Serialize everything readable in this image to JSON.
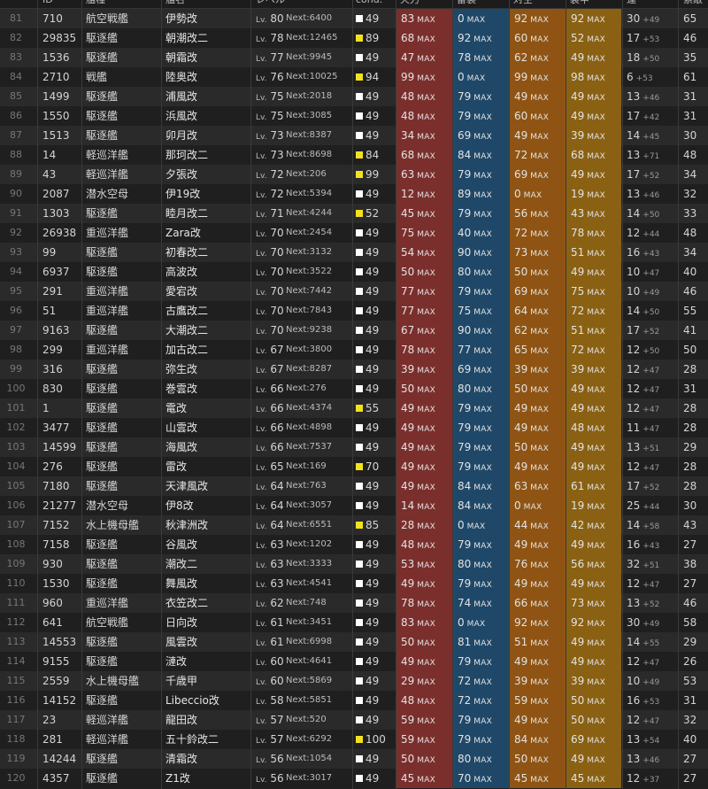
{
  "header": {
    "num": "",
    "id": "ID",
    "type": "艦種",
    "name": "艦名",
    "level": "レベル",
    "cond": "cond.",
    "firepower": "火力",
    "torpedo": "雷装",
    "aa": "対空",
    "armor": "装甲",
    "luck": "運",
    "extra": "索敵"
  },
  "colors": {
    "firepower": "#7b2f2c",
    "torpedo": "#1f4868",
    "antiair": "#8f5413",
    "armor": "#8a6113",
    "cond_yellow": "#f2e21e",
    "cond_white": "#ffffff"
  },
  "labels": {
    "lv": "Lv.",
    "next": "Next:",
    "max": "MAX"
  },
  "rows": [
    {
      "num": "81",
      "id": "710",
      "type": "航空戦艦",
      "name": "伊勢改",
      "lv": "80",
      "next": "6400",
      "cond": "49",
      "fp": "83",
      "tp": "0",
      "aa": "92",
      "ar": "92",
      "luck": "30",
      "luck_add": "+49",
      "ex": "65"
    },
    {
      "num": "82",
      "id": "29835",
      "type": "駆逐艦",
      "name": "朝潮改二",
      "lv": "78",
      "next": "12465",
      "cond": "89",
      "fp": "68",
      "tp": "92",
      "aa": "60",
      "ar": "52",
      "luck": "17",
      "luck_add": "+53",
      "ex": "46"
    },
    {
      "num": "83",
      "id": "1536",
      "type": "駆逐艦",
      "name": "朝霜改",
      "lv": "77",
      "next": "9945",
      "cond": "49",
      "fp": "47",
      "tp": "78",
      "aa": "62",
      "ar": "49",
      "luck": "18",
      "luck_add": "+50",
      "ex": "35"
    },
    {
      "num": "84",
      "id": "2710",
      "type": "戦艦",
      "name": "陸奥改",
      "lv": "76",
      "next": "10025",
      "cond": "94",
      "fp": "99",
      "tp": "0",
      "aa": "99",
      "ar": "98",
      "luck": "6",
      "luck_add": "+53",
      "ex": "61"
    },
    {
      "num": "85",
      "id": "1499",
      "type": "駆逐艦",
      "name": "浦風改",
      "lv": "75",
      "next": "2018",
      "cond": "49",
      "fp": "48",
      "tp": "79",
      "aa": "49",
      "ar": "49",
      "luck": "13",
      "luck_add": "+46",
      "ex": "31"
    },
    {
      "num": "86",
      "id": "1550",
      "type": "駆逐艦",
      "name": "浜風改",
      "lv": "75",
      "next": "3085",
      "cond": "49",
      "fp": "48",
      "tp": "79",
      "aa": "60",
      "ar": "49",
      "luck": "17",
      "luck_add": "+42",
      "ex": "31"
    },
    {
      "num": "87",
      "id": "1513",
      "type": "駆逐艦",
      "name": "卯月改",
      "lv": "73",
      "next": "8387",
      "cond": "49",
      "fp": "34",
      "tp": "69",
      "aa": "49",
      "ar": "39",
      "luck": "14",
      "luck_add": "+45",
      "ex": "30"
    },
    {
      "num": "88",
      "id": "14",
      "type": "軽巡洋艦",
      "name": "那珂改二",
      "lv": "73",
      "next": "8698",
      "cond": "84",
      "fp": "68",
      "tp": "84",
      "aa": "72",
      "ar": "68",
      "luck": "13",
      "luck_add": "+71",
      "ex": "48"
    },
    {
      "num": "89",
      "id": "43",
      "type": "軽巡洋艦",
      "name": "夕張改",
      "lv": "72",
      "next": "206",
      "cond": "99",
      "fp": "63",
      "tp": "79",
      "aa": "69",
      "ar": "49",
      "luck": "17",
      "luck_add": "+52",
      "ex": "34"
    },
    {
      "num": "90",
      "id": "2087",
      "type": "潜水空母",
      "name": "伊19改",
      "lv": "72",
      "next": "5394",
      "cond": "49",
      "fp": "12",
      "tp": "89",
      "aa": "0",
      "ar": "19",
      "luck": "13",
      "luck_add": "+46",
      "ex": "32"
    },
    {
      "num": "91",
      "id": "1303",
      "type": "駆逐艦",
      "name": "睦月改二",
      "lv": "71",
      "next": "4244",
      "cond": "52",
      "fp": "45",
      "tp": "79",
      "aa": "56",
      "ar": "43",
      "luck": "14",
      "luck_add": "+50",
      "ex": "33"
    },
    {
      "num": "92",
      "id": "26938",
      "type": "重巡洋艦",
      "name": "Zara改",
      "lv": "70",
      "next": "2454",
      "cond": "49",
      "fp": "75",
      "tp": "40",
      "aa": "72",
      "ar": "78",
      "luck": "12",
      "luck_add": "+44",
      "ex": "48"
    },
    {
      "num": "93",
      "id": "99",
      "type": "駆逐艦",
      "name": "初春改二",
      "lv": "70",
      "next": "3132",
      "cond": "49",
      "fp": "54",
      "tp": "90",
      "aa": "73",
      "ar": "51",
      "luck": "16",
      "luck_add": "+43",
      "ex": "34"
    },
    {
      "num": "94",
      "id": "6937",
      "type": "駆逐艦",
      "name": "高波改",
      "lv": "70",
      "next": "3522",
      "cond": "49",
      "fp": "50",
      "tp": "80",
      "aa": "50",
      "ar": "49",
      "luck": "10",
      "luck_add": "+47",
      "ex": "40"
    },
    {
      "num": "95",
      "id": "291",
      "type": "重巡洋艦",
      "name": "愛宕改",
      "lv": "70",
      "next": "7442",
      "cond": "49",
      "fp": "77",
      "tp": "79",
      "aa": "69",
      "ar": "75",
      "luck": "10",
      "luck_add": "+49",
      "ex": "46"
    },
    {
      "num": "96",
      "id": "51",
      "type": "重巡洋艦",
      "name": "古鷹改二",
      "lv": "70",
      "next": "7843",
      "cond": "49",
      "fp": "77",
      "tp": "75",
      "aa": "64",
      "ar": "72",
      "luck": "14",
      "luck_add": "+50",
      "ex": "55"
    },
    {
      "num": "97",
      "id": "9163",
      "type": "駆逐艦",
      "name": "大潮改二",
      "lv": "70",
      "next": "9238",
      "cond": "49",
      "fp": "67",
      "tp": "90",
      "aa": "62",
      "ar": "51",
      "luck": "17",
      "luck_add": "+52",
      "ex": "41"
    },
    {
      "num": "98",
      "id": "299",
      "type": "重巡洋艦",
      "name": "加古改二",
      "lv": "67",
      "next": "3800",
      "cond": "49",
      "fp": "78",
      "tp": "77",
      "aa": "65",
      "ar": "72",
      "luck": "12",
      "luck_add": "+50",
      "ex": "50"
    },
    {
      "num": "99",
      "id": "316",
      "type": "駆逐艦",
      "name": "弥生改",
      "lv": "67",
      "next": "8287",
      "cond": "49",
      "fp": "39",
      "tp": "69",
      "aa": "39",
      "ar": "39",
      "luck": "12",
      "luck_add": "+47",
      "ex": "28"
    },
    {
      "num": "100",
      "id": "830",
      "type": "駆逐艦",
      "name": "巻雲改",
      "lv": "66",
      "next": "276",
      "cond": "49",
      "fp": "50",
      "tp": "80",
      "aa": "50",
      "ar": "49",
      "luck": "12",
      "luck_add": "+47",
      "ex": "31"
    },
    {
      "num": "101",
      "id": "1",
      "type": "駆逐艦",
      "name": "電改",
      "lv": "66",
      "next": "4374",
      "cond": "55",
      "fp": "49",
      "tp": "79",
      "aa": "49",
      "ar": "49",
      "luck": "12",
      "luck_add": "+47",
      "ex": "28"
    },
    {
      "num": "102",
      "id": "3477",
      "type": "駆逐艦",
      "name": "山雲改",
      "lv": "66",
      "next": "4898",
      "cond": "49",
      "fp": "49",
      "tp": "79",
      "aa": "49",
      "ar": "48",
      "luck": "11",
      "luck_add": "+47",
      "ex": "28"
    },
    {
      "num": "103",
      "id": "14599",
      "type": "駆逐艦",
      "name": "海風改",
      "lv": "66",
      "next": "7537",
      "cond": "49",
      "fp": "49",
      "tp": "79",
      "aa": "50",
      "ar": "49",
      "luck": "13",
      "luck_add": "+51",
      "ex": "29"
    },
    {
      "num": "104",
      "id": "276",
      "type": "駆逐艦",
      "name": "雷改",
      "lv": "65",
      "next": "169",
      "cond": "70",
      "fp": "49",
      "tp": "79",
      "aa": "49",
      "ar": "49",
      "luck": "12",
      "luck_add": "+47",
      "ex": "28"
    },
    {
      "num": "105",
      "id": "7180",
      "type": "駆逐艦",
      "name": "天津風改",
      "lv": "64",
      "next": "763",
      "cond": "49",
      "fp": "49",
      "tp": "84",
      "aa": "63",
      "ar": "61",
      "luck": "17",
      "luck_add": "+52",
      "ex": "28"
    },
    {
      "num": "106",
      "id": "21277",
      "type": "潜水空母",
      "name": "伊8改",
      "lv": "64",
      "next": "3057",
      "cond": "49",
      "fp": "14",
      "tp": "84",
      "aa": "0",
      "ar": "19",
      "luck": "25",
      "luck_add": "+44",
      "ex": "30"
    },
    {
      "num": "107",
      "id": "7152",
      "type": "水上機母艦",
      "name": "秋津洲改",
      "lv": "64",
      "next": "6551",
      "cond": "85",
      "fp": "28",
      "tp": "0",
      "aa": "44",
      "ar": "42",
      "luck": "14",
      "luck_add": "+58",
      "ex": "43"
    },
    {
      "num": "108",
      "id": "7158",
      "type": "駆逐艦",
      "name": "谷風改",
      "lv": "63",
      "next": "1202",
      "cond": "49",
      "fp": "48",
      "tp": "79",
      "aa": "49",
      "ar": "49",
      "luck": "16",
      "luck_add": "+43",
      "ex": "27"
    },
    {
      "num": "109",
      "id": "930",
      "type": "駆逐艦",
      "name": "潮改二",
      "lv": "63",
      "next": "3333",
      "cond": "49",
      "fp": "53",
      "tp": "80",
      "aa": "76",
      "ar": "56",
      "luck": "32",
      "luck_add": "+51",
      "ex": "38"
    },
    {
      "num": "110",
      "id": "1530",
      "type": "駆逐艦",
      "name": "舞風改",
      "lv": "63",
      "next": "4541",
      "cond": "49",
      "fp": "49",
      "tp": "79",
      "aa": "49",
      "ar": "49",
      "luck": "12",
      "luck_add": "+47",
      "ex": "27"
    },
    {
      "num": "111",
      "id": "960",
      "type": "重巡洋艦",
      "name": "衣笠改二",
      "lv": "62",
      "next": "748",
      "cond": "49",
      "fp": "78",
      "tp": "74",
      "aa": "66",
      "ar": "73",
      "luck": "13",
      "luck_add": "+52",
      "ex": "46"
    },
    {
      "num": "112",
      "id": "641",
      "type": "航空戦艦",
      "name": "日向改",
      "lv": "61",
      "next": "3451",
      "cond": "49",
      "fp": "83",
      "tp": "0",
      "aa": "92",
      "ar": "92",
      "luck": "30",
      "luck_add": "+49",
      "ex": "58"
    },
    {
      "num": "113",
      "id": "14553",
      "type": "駆逐艦",
      "name": "風雲改",
      "lv": "61",
      "next": "6998",
      "cond": "49",
      "fp": "50",
      "tp": "81",
      "aa": "51",
      "ar": "49",
      "luck": "14",
      "luck_add": "+55",
      "ex": "29"
    },
    {
      "num": "114",
      "id": "9155",
      "type": "駆逐艦",
      "name": "漣改",
      "lv": "60",
      "next": "4641",
      "cond": "49",
      "fp": "49",
      "tp": "79",
      "aa": "49",
      "ar": "49",
      "luck": "12",
      "luck_add": "+47",
      "ex": "26"
    },
    {
      "num": "115",
      "id": "2559",
      "type": "水上機母艦",
      "name": "千歳甲",
      "lv": "60",
      "next": "5869",
      "cond": "49",
      "fp": "29",
      "tp": "72",
      "aa": "39",
      "ar": "39",
      "luck": "10",
      "luck_add": "+49",
      "ex": "53"
    },
    {
      "num": "116",
      "id": "14152",
      "type": "駆逐艦",
      "name": "Libeccio改",
      "lv": "58",
      "next": "5851",
      "cond": "49",
      "fp": "48",
      "tp": "72",
      "aa": "59",
      "ar": "50",
      "luck": "16",
      "luck_add": "+53",
      "ex": "31"
    },
    {
      "num": "117",
      "id": "23",
      "type": "軽巡洋艦",
      "name": "龍田改",
      "lv": "57",
      "next": "520",
      "cond": "49",
      "fp": "59",
      "tp": "79",
      "aa": "49",
      "ar": "50",
      "luck": "12",
      "luck_add": "+47",
      "ex": "32"
    },
    {
      "num": "118",
      "id": "281",
      "type": "軽巡洋艦",
      "name": "五十鈴改二",
      "lv": "57",
      "next": "6292",
      "cond": "100",
      "fp": "59",
      "tp": "79",
      "aa": "84",
      "ar": "69",
      "luck": "13",
      "luck_add": "+54",
      "ex": "40"
    },
    {
      "num": "119",
      "id": "14244",
      "type": "駆逐艦",
      "name": "清霜改",
      "lv": "56",
      "next": "1054",
      "cond": "49",
      "fp": "50",
      "tp": "80",
      "aa": "50",
      "ar": "49",
      "luck": "13",
      "luck_add": "+46",
      "ex": "27"
    },
    {
      "num": "120",
      "id": "4357",
      "type": "駆逐艦",
      "name": "Z1改",
      "lv": "56",
      "next": "3017",
      "cond": "49",
      "fp": "45",
      "tp": "70",
      "aa": "45",
      "ar": "45",
      "luck": "12",
      "luck_add": "+37",
      "ex": "27"
    }
  ]
}
